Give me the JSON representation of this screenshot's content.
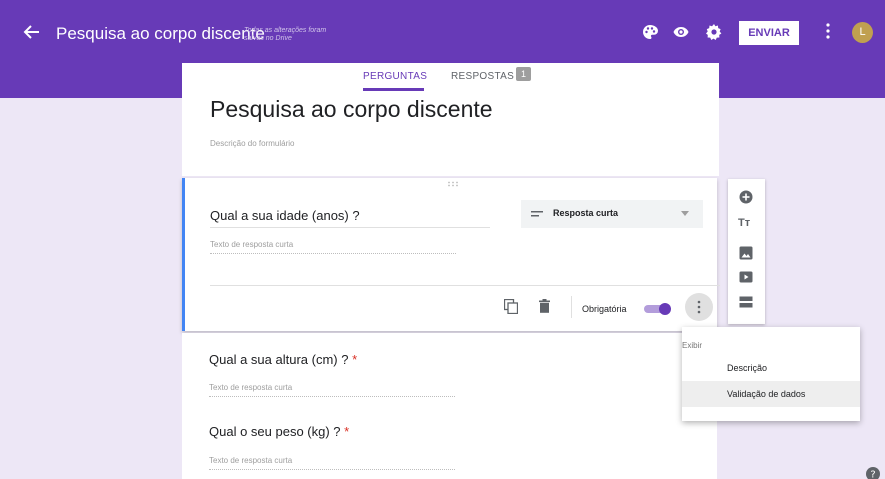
{
  "header": {
    "form_title": "Pesquisa ao corpo discente",
    "save_status_line1": "Todas as alterações foram",
    "save_status_line2": "salvas no Drive",
    "send_label": "ENVIAR",
    "avatar_initial": "L",
    "icons": [
      "back-arrow-icon",
      "palette-icon",
      "preview-eye-icon",
      "settings-gear-icon",
      "more-vert-icon"
    ]
  },
  "tabs": {
    "questions_label": "PERGUNTAS",
    "responses_label": "RESPOSTAS",
    "responses_count": "1"
  },
  "form": {
    "title": "Pesquisa ao corpo discente",
    "description_placeholder": "Descrição do formulário"
  },
  "active_question": {
    "title": "Qual a sua idade (anos) ?",
    "answer_placeholder": "Texto de resposta curta",
    "type_label": "Resposta curta",
    "required_label": "Obrigatória",
    "required_on": true
  },
  "questions": [
    {
      "title": "Qual a sua altura (cm) ?",
      "required_mark": "*",
      "answer_placeholder": "Texto de resposta curta"
    },
    {
      "title": "Qual o seu peso (kg) ?",
      "required_mark": "*",
      "answer_placeholder": "Texto de resposta curta"
    }
  ],
  "side_toolbar": {
    "title_tool_label": "Tт",
    "icons": [
      "add-circle-icon",
      "title-text-icon",
      "image-icon",
      "video-icon",
      "section-icon"
    ]
  },
  "more_menu": {
    "header": "Exibir",
    "items": [
      "Descrição",
      "Validação de dados"
    ],
    "highlighted_item": "Validação de dados"
  },
  "colors": {
    "primary": "#673ab7",
    "background": "#ede7f6",
    "active_border": "#4285f4",
    "required_star": "#d93025"
  }
}
